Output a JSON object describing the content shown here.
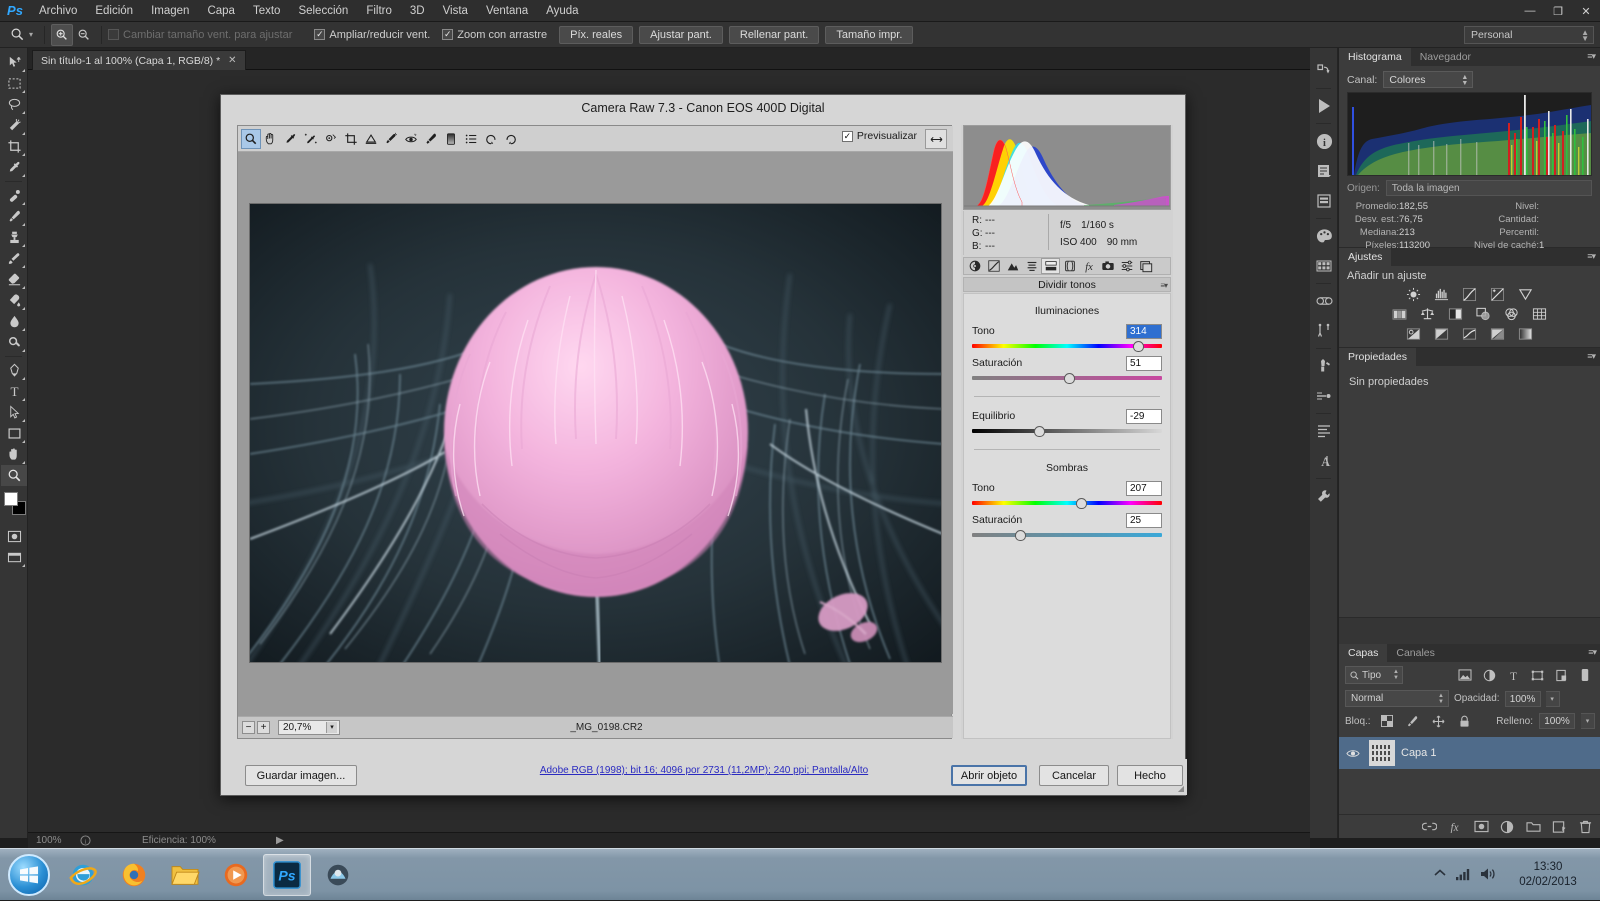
{
  "app": {
    "logo": "Ps",
    "menus": [
      "Archivo",
      "Edición",
      "Imagen",
      "Capa",
      "Texto",
      "Selección",
      "Filtro",
      "3D",
      "Vista",
      "Ventana",
      "Ayuda"
    ],
    "window_buttons": {
      "minimize": "—",
      "maximize": "❐",
      "close": "✕"
    }
  },
  "options_bar": {
    "resize_windows_label": "Cambiar tamaño vent. para ajustar",
    "zoom_resize_label": "Ampliar/reducir vent.",
    "scrubby_zoom_label": "Zoom con arrastre",
    "buttons": [
      "Píx. reales",
      "Ajustar pant.",
      "Rellenar pant.",
      "Tamaño impr."
    ],
    "workspace": "Personal"
  },
  "document_tab": {
    "title": "Sin título-1 al 100% (Capa 1, RGB/8) *",
    "close": "✕"
  },
  "status_bar": {
    "zoom": "100%",
    "efficiency": "Eficiencia: 100%",
    "arrow": "▶"
  },
  "camera_raw": {
    "title": "Camera Raw 7.3 -  Canon EOS 400D Digital",
    "preview_checkbox_label": "Previsualizar",
    "preview_checked": true,
    "toolbar_icons": [
      "zoom-tool-icon",
      "hand-tool-icon",
      "white-balance-tool-icon",
      "color-sampler-tool-icon",
      "targeted-adjustment-tool-icon",
      "crop-tool-icon",
      "straighten-tool-icon",
      "spot-removal-tool-icon",
      "red-eye-tool-icon",
      "adjustment-brush-tool-icon",
      "graduated-filter-tool-icon",
      "presets-tool-icon",
      "rotate-left-icon",
      "rotate-right-icon"
    ],
    "selected_tool": "zoom-tool-icon",
    "zoom_level": "20,7%",
    "filename": "_MG_0198.CR2",
    "exif": {
      "r_label": "R:",
      "r_value": "---",
      "g_label": "G:",
      "g_value": "---",
      "b_label": "B:",
      "b_value": "---",
      "aperture": "f/5",
      "shutter": "1/160 s",
      "iso": "ISO 400",
      "focal": "90 mm"
    },
    "panel_tabs": [
      "basic-panel-icon",
      "tone-curve-panel-icon",
      "detail-panel-icon",
      "hsl-panel-icon",
      "split-toning-panel-icon",
      "lens-corrections-panel-icon",
      "effects-panel-icon",
      "camera-calibration-panel-icon",
      "presets-panel-icon",
      "snapshots-panel-icon"
    ],
    "active_panel_index": 4,
    "panel_title": "Dividir tonos",
    "panel_menu": "≡▾",
    "highlights": {
      "section": "Iluminaciones",
      "hue_label": "Tono",
      "hue_value": "314",
      "hue_active": true,
      "sat_label": "Saturación",
      "sat_value": "51"
    },
    "balance": {
      "label": "Equilibrio",
      "value": "-29"
    },
    "shadows": {
      "section": "Sombras",
      "hue_label": "Tono",
      "hue_value": "207",
      "sat_label": "Saturación",
      "sat_value": "25"
    },
    "footer": {
      "save_button": "Guardar imagen...",
      "workflow_link": "Adobe RGB (1998); bit 16; 4096 por 2731 (11,2MP); 240 ppi; Pantalla/Alto",
      "open_object_button": "Abrir objeto",
      "cancel_button": "Cancelar",
      "done_button": "Hecho"
    }
  },
  "panels": {
    "histogram": {
      "tabs": [
        "Histograma",
        "Navegador"
      ],
      "active_tab": "Histograma",
      "channel_label": "Canal:",
      "channel_value": "Colores",
      "source_label": "Origen:",
      "source_value": "Toda la imagen",
      "stats": [
        {
          "label": "Promedio:",
          "value": "182,55",
          "label2": "Nivel:",
          "value2": ""
        },
        {
          "label": "Desv. est.:",
          "value": "76,75",
          "label2": "Cantidad:",
          "value2": ""
        },
        {
          "label": "Mediana:",
          "value": "213",
          "label2": "Percentil:",
          "value2": ""
        },
        {
          "label": "Píxeles:",
          "value": "113200",
          "label2": "Nivel de caché:",
          "value2": "1"
        }
      ]
    },
    "adjustments": {
      "tab": "Ajustes",
      "heading": "Añadir un ajuste",
      "row1": [
        "brightness-contrast-icon",
        "levels-icon",
        "curves-icon",
        "exposure-icon",
        "vibrance-icon"
      ],
      "row2": [
        "hue-saturation-icon",
        "color-balance-icon",
        "black-white-icon",
        "photo-filter-icon",
        "channel-mixer-icon",
        "color-lookup-icon"
      ],
      "row3": [
        "invert-icon",
        "posterize-icon",
        "threshold-icon",
        "selective-color-icon",
        "gradient-map-icon"
      ]
    },
    "properties": {
      "tab": "Propiedades",
      "empty_text": "Sin propiedades"
    },
    "layers": {
      "tabs": [
        "Capas",
        "Canales"
      ],
      "active_tab": "Capas",
      "filter_label": "Tipo",
      "blend_mode": "Normal",
      "opacity_label": "Opacidad:",
      "opacity_value": "100%",
      "lock_label": "Bloq.:",
      "fill_label": "Relleno:",
      "fill_value": "100%",
      "layer_name": "Capa 1",
      "footer_icons": [
        "link-layers-icon",
        "layer-style-icon",
        "layer-mask-icon",
        "adjustment-layer-icon",
        "new-group-icon",
        "new-layer-icon",
        "delete-layer-icon"
      ]
    }
  },
  "dock_icons": [
    "mini-bridge-icon",
    "timeline-play-icon",
    "info-icon",
    "notes-icon",
    "history-icon",
    "color-icon",
    "swatches-icon",
    "styles-icon",
    "actions-icon",
    "paths-icon",
    "brush-presets-icon",
    "clone-source-icon",
    "paragraph-icon",
    "character-icon",
    "tool-presets-icon"
  ],
  "taskbar": {
    "start": "start-orb-icon",
    "items": [
      "internet-explorer-icon",
      "firefox-icon",
      "explorer-icon",
      "media-player-icon",
      "photoshop-icon",
      "raw-app-icon"
    ],
    "active_item": "photoshop-icon",
    "tray": [
      "show-hidden-icon",
      "network-icon",
      "volume-icon"
    ],
    "time": "13:30",
    "date": "02/02/2013"
  }
}
